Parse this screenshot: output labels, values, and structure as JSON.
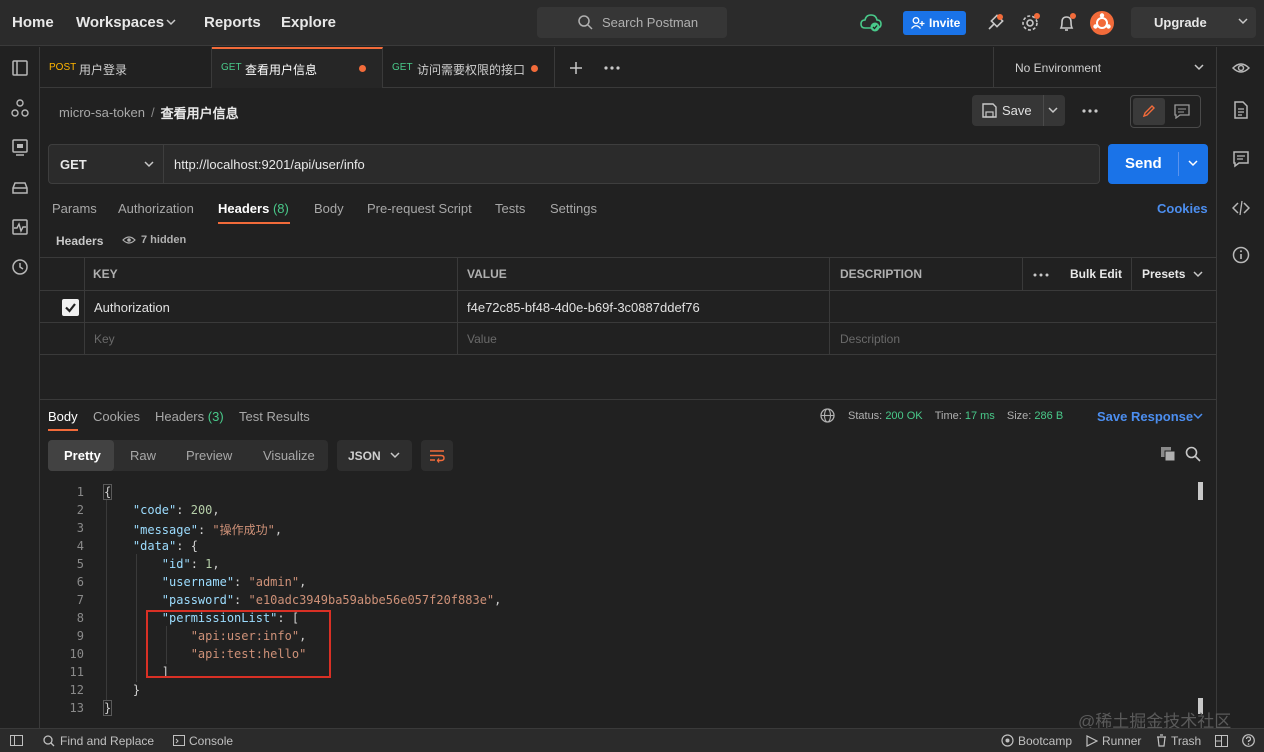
{
  "topbar": {
    "nav": [
      "Home",
      "Workspaces",
      "Reports",
      "Explore"
    ],
    "search_placeholder": "Search Postman",
    "invite_label": "Invite",
    "upgrade_label": "Upgrade",
    "brand_color": "#ff6c37",
    "accent_color": "#1a73e8"
  },
  "tabs": [
    {
      "method": "POST",
      "title": "用户登录",
      "method_color": "#ffb400",
      "unsaved": false,
      "active": false
    },
    {
      "method": "GET",
      "title": "查看用户信息",
      "method_color": "#49c98a",
      "unsaved": true,
      "active": true
    },
    {
      "method": "GET",
      "title": "访问需要权限的接口",
      "method_color": "#49c98a",
      "unsaved": true,
      "active": false
    }
  ],
  "environment": "No Environment",
  "breadcrumb": {
    "collection": "micro-sa-token",
    "separator": "/",
    "request": "查看用户信息"
  },
  "save_label": "Save",
  "request": {
    "method": "GET",
    "url": "http://localhost:9201/api/user/info",
    "send_label": "Send"
  },
  "request_tabs": [
    {
      "label": "Params"
    },
    {
      "label": "Authorization"
    },
    {
      "label": "Headers",
      "count": "(8)",
      "active": true
    },
    {
      "label": "Body"
    },
    {
      "label": "Pre-request Script"
    },
    {
      "label": "Tests"
    },
    {
      "label": "Settings"
    }
  ],
  "cookies_link": "Cookies",
  "headers_section": {
    "title": "Headers",
    "hidden": "7 hidden"
  },
  "headers_table": {
    "columns": [
      "KEY",
      "VALUE",
      "DESCRIPTION"
    ],
    "bulk_edit": "Bulk Edit",
    "presets": "Presets",
    "rows": [
      {
        "checked": true,
        "key": "Authorization",
        "value": "f4e72c85-bf48-4d0e-b69f-3c0887ddef76",
        "description": ""
      }
    ],
    "placeholders": {
      "key": "Key",
      "value": "Value",
      "description": "Description"
    }
  },
  "response_tabs": [
    {
      "label": "Body",
      "active": true
    },
    {
      "label": "Cookies"
    },
    {
      "label": "Headers",
      "count": "(3)"
    },
    {
      "label": "Test Results"
    }
  ],
  "response_meta": {
    "status_label": "Status:",
    "status": "200 OK",
    "time_label": "Time:",
    "time": "17 ms",
    "size_label": "Size:",
    "size": "286 B",
    "save_response": "Save Response"
  },
  "view_modes": [
    "Pretty",
    "Raw",
    "Preview",
    "Visualize"
  ],
  "format": "JSON",
  "code_lines": [
    "1",
    "2",
    "3",
    "4",
    "5",
    "6",
    "7",
    "8",
    "9",
    "10",
    "11",
    "12",
    "13"
  ],
  "json": {
    "code_key": "\"code\"",
    "code_val": "200",
    "message_key": "\"message\"",
    "message_val": "\"操作成功\"",
    "data_key": "\"data\"",
    "id_key": "\"id\"",
    "id_val": "1",
    "username_key": "\"username\"",
    "username_val": "\"admin\"",
    "password_key": "\"password\"",
    "password_val": "\"e10adc3949ba59abbe56e057f20f883e\"",
    "perm_key": "\"permissionList\"",
    "perm_1": "\"api:user:info\"",
    "perm_2": "\"api:test:hello\""
  },
  "statusbar": {
    "find_replace": "Find and Replace",
    "console": "Console",
    "bootcamp": "Bootcamp",
    "runner": "Runner",
    "trash": "Trash"
  },
  "watermark": "@稀土掘金技术社区"
}
